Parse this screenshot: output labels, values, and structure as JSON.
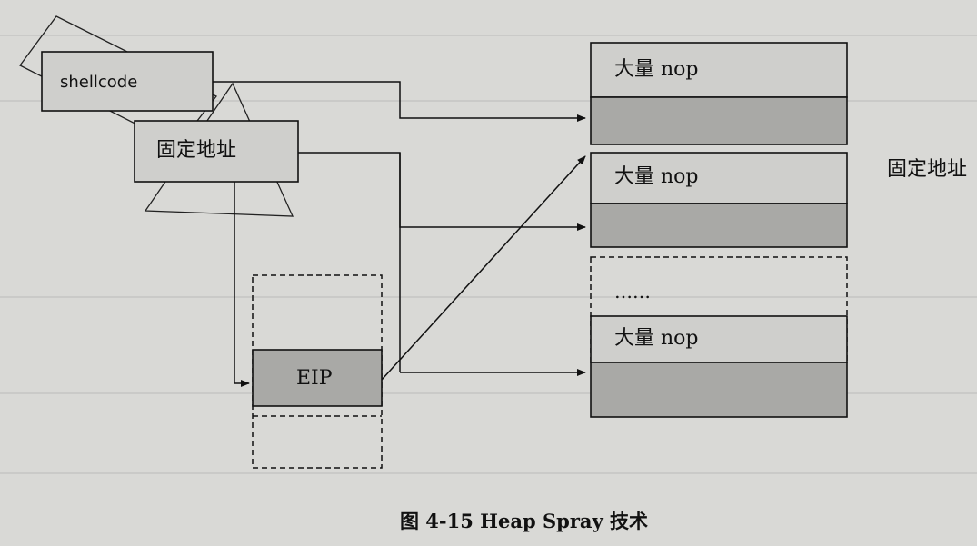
{
  "figure": {
    "caption": "图 4-15   Heap Spray 技术"
  },
  "left": {
    "shellcode_label": "shellcode",
    "fixed_address_label": "固定地址",
    "eip_label": "EIP"
  },
  "heap": {
    "blocks": [
      {
        "label": "大量   nop",
        "shaded_tail": true
      },
      {
        "label": "大量   nop",
        "shaded_tail": true
      },
      {
        "label": "……",
        "shaded_tail": false
      },
      {
        "label": "大量   nop",
        "shaded_tail": true
      }
    ],
    "fixed_address_label": "固定地址"
  },
  "colors": {
    "box_fill": "#cfcfcc",
    "shaded_fill": "#a9a9a6",
    "line": "#111111",
    "background": "#d9d9d6"
  }
}
